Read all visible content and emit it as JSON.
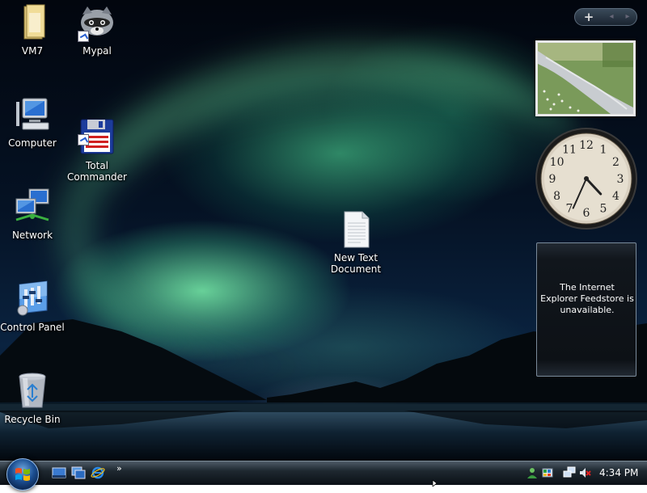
{
  "desktop": {
    "icons": [
      {
        "id": "vm7",
        "label": "VM7"
      },
      {
        "id": "mypal",
        "label": "Mypal"
      },
      {
        "id": "computer",
        "label": "Computer"
      },
      {
        "id": "total_commander",
        "label": "Total\nCommander"
      },
      {
        "id": "network",
        "label": "Network"
      },
      {
        "id": "new_text_document",
        "label": "New Text\nDocument"
      },
      {
        "id": "control_panel",
        "label": "Control Panel"
      },
      {
        "id": "recycle_bin",
        "label": "Recycle Bin"
      }
    ]
  },
  "sidebar": {
    "add_label": "+",
    "prev_label": "◂",
    "next_label": "▸",
    "feed_message": "The Internet Explorer Feedstore is unavailable.",
    "clock": {
      "hour": 4,
      "minute": 34,
      "numerals": [
        "12",
        "1",
        "2",
        "3",
        "4",
        "5",
        "6",
        "7",
        "8",
        "9",
        "10",
        "11"
      ]
    }
  },
  "taskbar": {
    "quick_launch_chevron": "»",
    "clock_text": "4:34 PM"
  },
  "colors": {
    "taskbar": "#1e2830",
    "aurora": "#78f0aa",
    "sky": "#051224"
  }
}
